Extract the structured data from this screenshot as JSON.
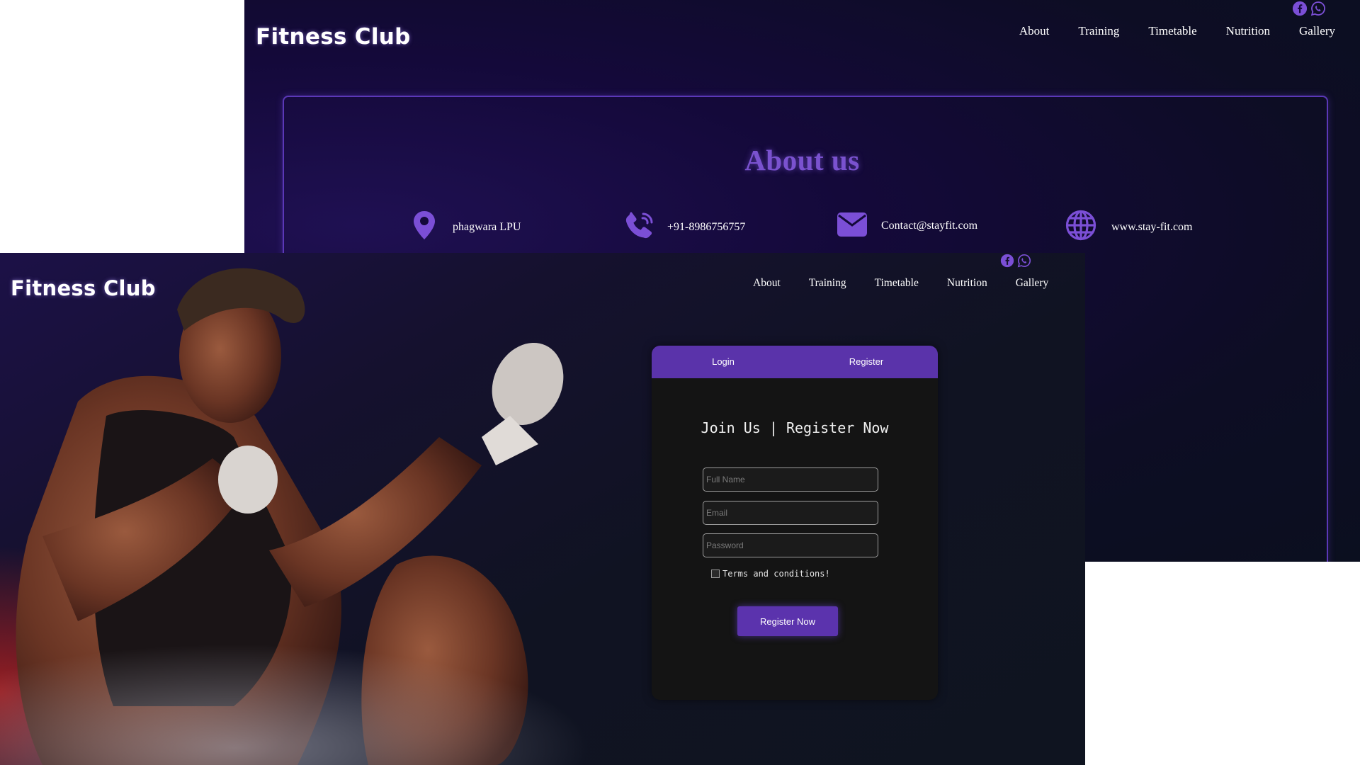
{
  "back_window": {
    "brand": "Fitness Club",
    "nav": [
      "About",
      "Training",
      "Timetable",
      "Nutrition",
      "Gallery"
    ],
    "social_icons": [
      "facebook-icon",
      "whatsapp-icon"
    ],
    "about": {
      "title": "About us",
      "contacts": [
        {
          "icon": "location-pin-icon",
          "text": "phagwara LPU"
        },
        {
          "icon": "phone-icon",
          "text": "+91-8986756757"
        },
        {
          "icon": "mail-icon",
          "text": "Contact@stayfit.com"
        },
        {
          "icon": "globe-icon",
          "text": "www.stay-fit.com"
        }
      ]
    }
  },
  "front_window": {
    "brand": "Fitness Club",
    "nav": [
      "About",
      "Training",
      "Timetable",
      "Nutrition",
      "Gallery"
    ],
    "social_icons": [
      "facebook-icon",
      "whatsapp-icon"
    ],
    "form": {
      "tabs": [
        "Login",
        "Register"
      ],
      "title": "Join Us | Register Now",
      "fields": {
        "full_name": "Full Name",
        "email": "Email",
        "password": "Password"
      },
      "terms_label": "Terms and conditions!",
      "submit_label": "Register Now"
    }
  },
  "colors": {
    "accent": "#5a33aa",
    "about_title": "#7a52cf",
    "icon": "#7b4fd6"
  }
}
